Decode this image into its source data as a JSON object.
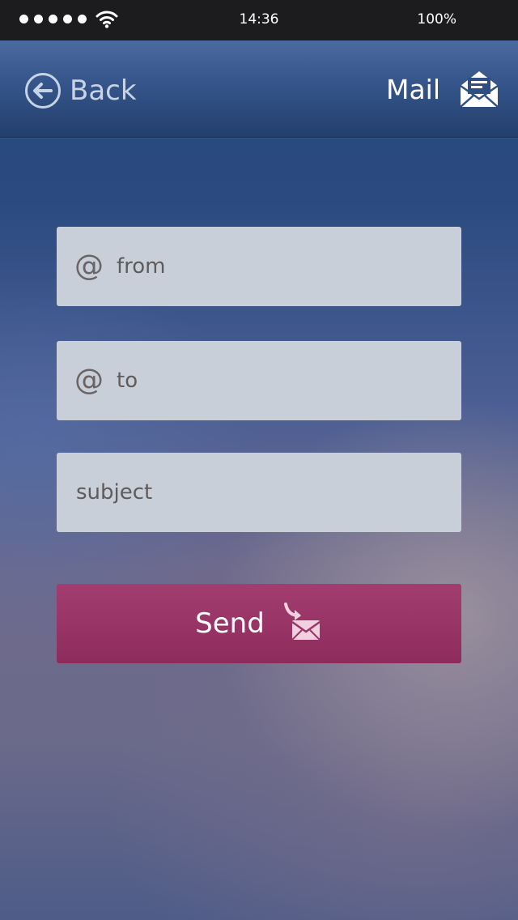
{
  "status_bar": {
    "time": "14:36",
    "battery": "100%",
    "signal_bars": 5,
    "signal_icon": "signal-dots-icon",
    "wifi_icon": "wifi-icon"
  },
  "nav": {
    "back_label": "Back",
    "back_icon": "back-arrow-circle-icon",
    "title": "Mail",
    "title_icon": "open-envelope-icon"
  },
  "form": {
    "from": {
      "placeholder": "from",
      "value": "",
      "icon": "at-icon",
      "icon_glyph": "@"
    },
    "to": {
      "placeholder": "to",
      "value": "",
      "icon": "at-icon",
      "icon_glyph": "@"
    },
    "subject": {
      "placeholder": "subject",
      "value": ""
    }
  },
  "send": {
    "label": "Send",
    "icon": "send-envelope-icon"
  },
  "colors": {
    "status_bar": "#1c1c1e",
    "nav_bar": "#35558a",
    "field_bg": "#c8cfd9",
    "send_button": "#9a3566",
    "send_icon": "#f2d0e0",
    "back_label": "#c7d3e7"
  }
}
